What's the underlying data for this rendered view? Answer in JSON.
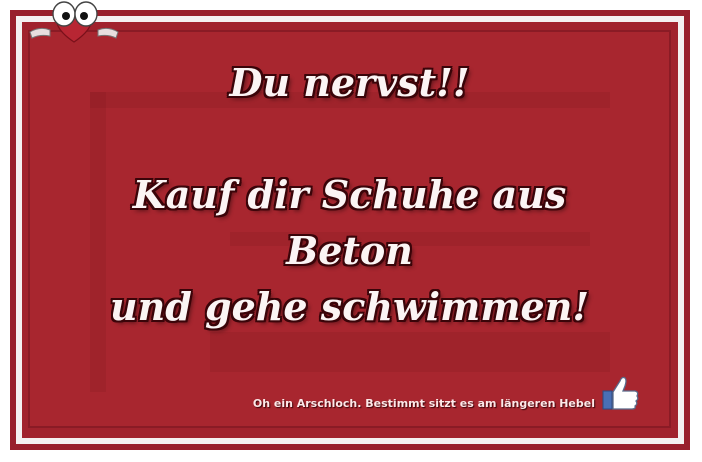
{
  "poster": {
    "line1": "Du nervst!!",
    "line2": "Kauf dir Schuhe aus",
    "line3": "Beton",
    "line4": "und gehe schwimmen!",
    "caption": "Oh ein Arschloch. Bestimmt sitzt es am längeren Hebel"
  },
  "colors": {
    "panel": "#a8262f",
    "frame": "#98202c",
    "text": "#fbf4f4",
    "thumb": "#4a6fb5"
  },
  "icons": {
    "mascot": "peeking-eyes-heart-icon",
    "thumb": "thumbs-up-icon"
  }
}
